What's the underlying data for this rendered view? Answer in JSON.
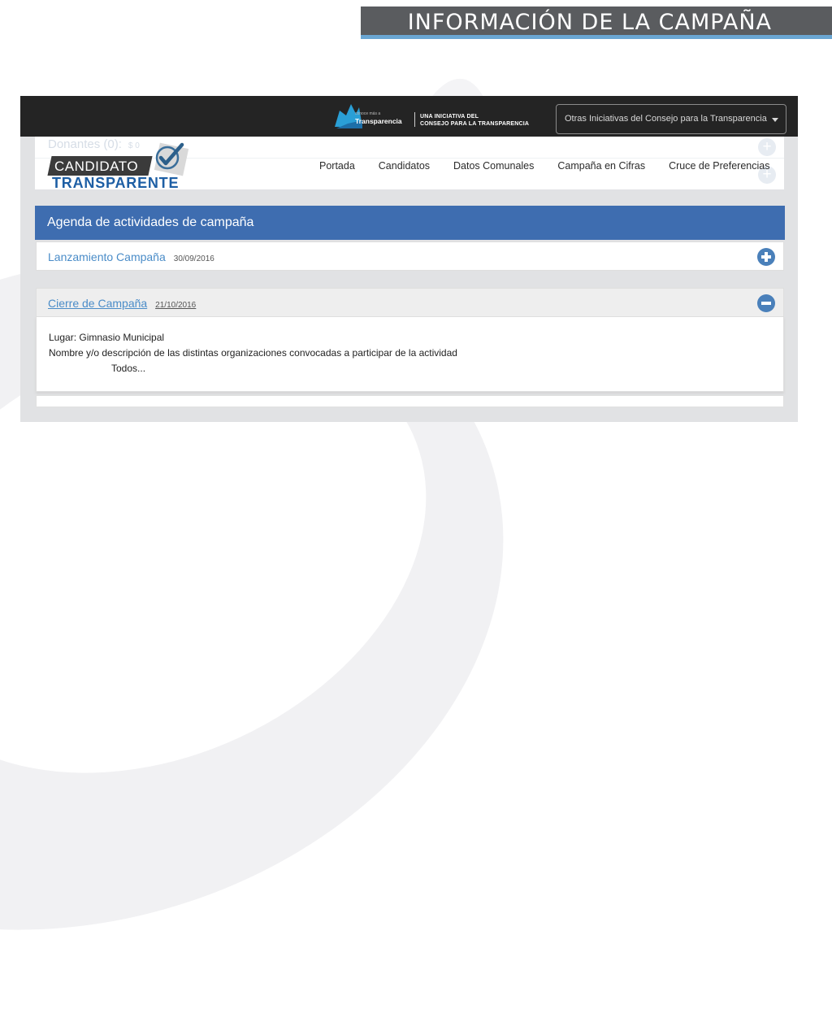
{
  "slide": {
    "title": "INFORMACIÓN DE LA CAMPAÑA"
  },
  "topbar": {
    "brand_small": "conoce más a",
    "brand_name": "Transparencia",
    "tagline_line1": "UNA INICIATIVA DEL",
    "tagline_line2": "CONSEJO PARA LA TRANSPARENCIA",
    "initiatives_label": "Otras Iniciativas del Consejo para la Transparencia"
  },
  "ghost": {
    "donors_label": "Donantes (0):",
    "donors_amount": "$ 0"
  },
  "logo": {
    "line1": "CANDIDATO",
    "line2": "TRANSPARENTE"
  },
  "nav": {
    "items": [
      {
        "label": "Portada"
      },
      {
        "label": "Candidatos"
      },
      {
        "label": "Datos Comunales"
      },
      {
        "label": "Campaña en Cifras"
      },
      {
        "label": "Cruce de Preferencias"
      }
    ]
  },
  "agenda": {
    "header": "Agenda de actividades de campaña",
    "events": [
      {
        "title": "Lanzamiento Campaña",
        "date": "30/09/2016",
        "expanded": false,
        "icon": "plus-circle-icon"
      },
      {
        "title": "Cierre de Campaña",
        "date": "21/10/2016",
        "expanded": true,
        "icon": "minus-circle-icon"
      }
    ],
    "detail": {
      "place": "Lugar: Gimnasio Municipal",
      "description_label": "Nombre y/o descripción de las distintas organizaciones convocadas a participar de la actividad",
      "description_value": "Todos..."
    }
  },
  "colors": {
    "topbar": "#242424",
    "header_blue": "#3e6db0",
    "link_blue": "#4a8cc8",
    "logo_blue": "#1d5ea4",
    "title_bar": "#5a5c5f",
    "title_accent": "#6aa6d2"
  }
}
